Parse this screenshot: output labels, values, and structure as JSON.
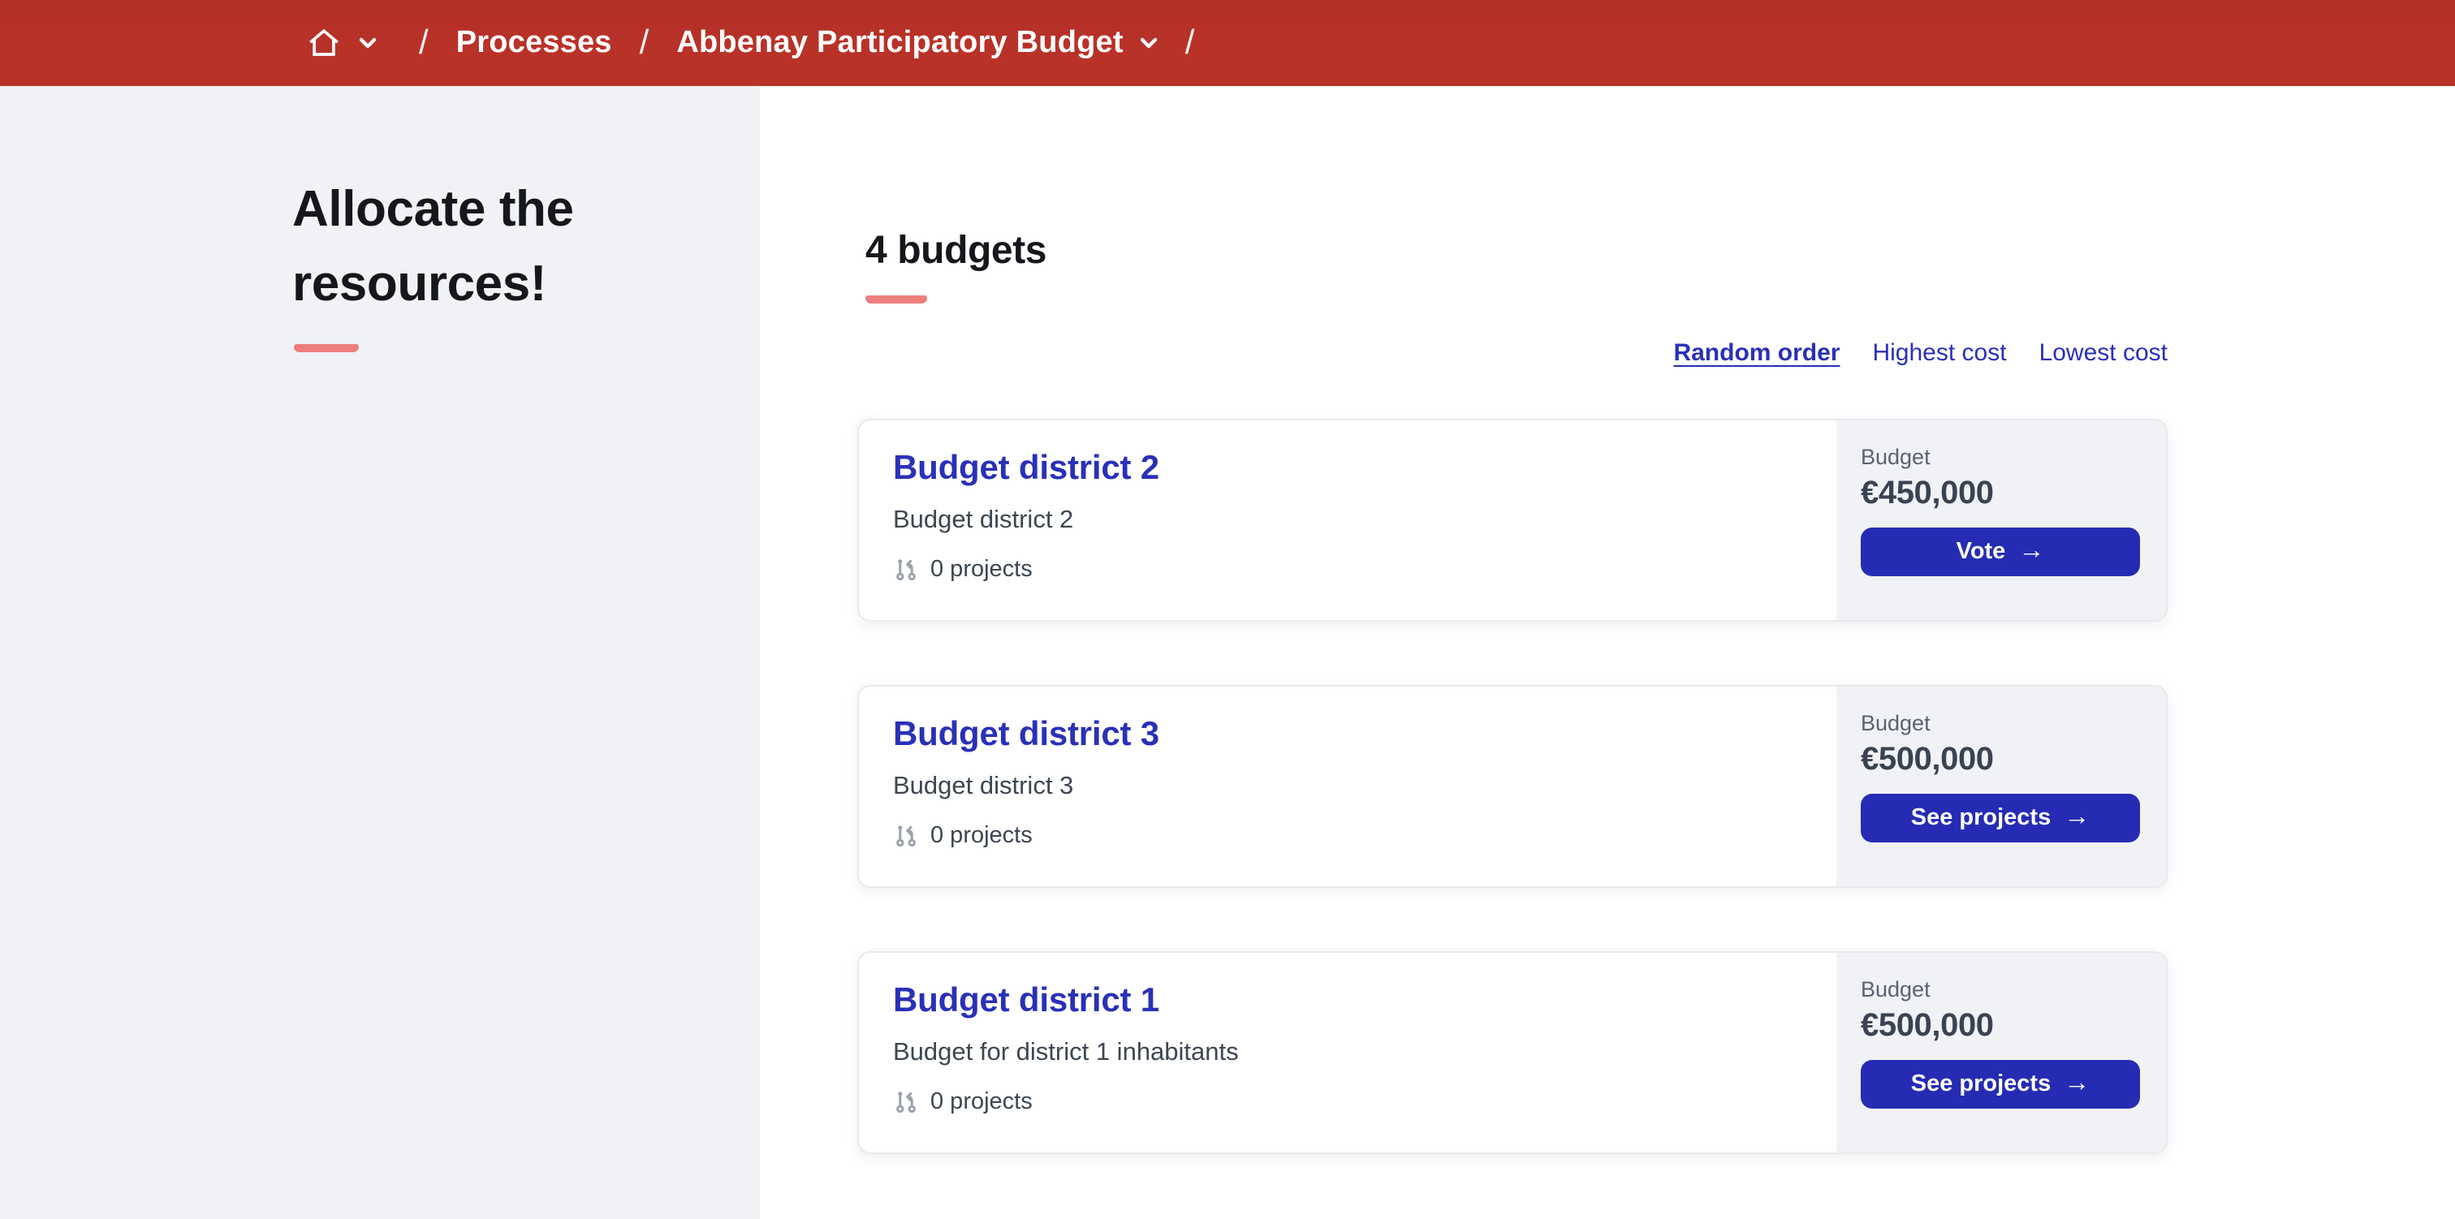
{
  "colors": {
    "topbar": "#B93228",
    "topbar_dark": "#B22F26",
    "sidebar_bg": "#F1F2F6",
    "panel_bg": "#F1F2F6",
    "accent_pink": "#EE7E7E",
    "link_blue": "#2A30B8",
    "button_blue": "#252CB3",
    "heading_text": "#15171C",
    "body_text": "#3D4652",
    "muted_text": "#5A6270",
    "icon_gray": "#9BA2AE"
  },
  "breadcrumb": {
    "separator": "/",
    "items": [
      {
        "label": "Processes"
      },
      {
        "label": "Abbenay Participatory Budget"
      }
    ]
  },
  "sidebar": {
    "heading": "Allocate the resources!"
  },
  "main": {
    "count_heading": "4 budgets",
    "sort_options": [
      {
        "label": "Random order",
        "active": true
      },
      {
        "label": "Highest cost",
        "active": false
      },
      {
        "label": "Lowest cost",
        "active": false
      }
    ],
    "budgets": [
      {
        "title": "Budget district 2",
        "description": "Budget district 2",
        "projects": "0 projects",
        "budget_label": "Budget",
        "amount": "€450,000",
        "action": "Vote"
      },
      {
        "title": "Budget district 3",
        "description": "Budget district 3",
        "projects": "0 projects",
        "budget_label": "Budget",
        "amount": "€500,000",
        "action": "See projects"
      },
      {
        "title": "Budget district 1",
        "description": "Budget for district 1 inhabitants",
        "projects": "0 projects",
        "budget_label": "Budget",
        "amount": "€500,000",
        "action": "See projects"
      }
    ]
  },
  "ui": {
    "arrow_icon": "→"
  }
}
